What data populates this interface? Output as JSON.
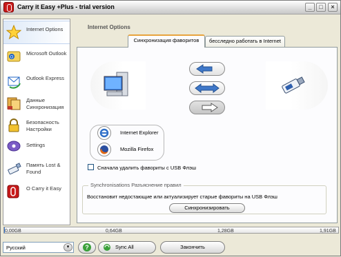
{
  "window": {
    "title": "Carry it Easy +Plus - trial version"
  },
  "titlebar": {
    "minimize": "_",
    "maximize": "□",
    "close": "×"
  },
  "sidebar": {
    "items": [
      {
        "label": "Internet Options",
        "icon": "star-icon"
      },
      {
        "label": "Microsoft Outlook",
        "icon": "outlook-icon"
      },
      {
        "label": "Outlook Express",
        "icon": "outlook-express-icon"
      },
      {
        "label": "Данные Синхронизация",
        "icon": "data-sync-icon"
      },
      {
        "label": "Безопасность Настройки",
        "icon": "lock-icon"
      },
      {
        "label": "Settings",
        "icon": "settings-icon"
      },
      {
        "label": "Память Lost & Found",
        "icon": "usb-drive-icon"
      },
      {
        "label": "О Carry it Easy",
        "icon": "about-icon"
      }
    ]
  },
  "main": {
    "title": "Internet Options",
    "tabs": [
      {
        "label": "Синхронизация фаворитов"
      },
      {
        "label": "бесследно работать в Internet"
      }
    ],
    "browsers": [
      {
        "label": "Internet Explorer",
        "icon": "internet-explorer-icon"
      },
      {
        "label": "Mozilla Firefox",
        "icon": "firefox-icon"
      }
    ],
    "delete_first_label": "Сначала удалить фавориты с USB Флэш",
    "delete_first_checked": false,
    "group_title": "Synchronisations Разъяснение правил",
    "group_text": "Восстановит недостающие или актуализирует старые фавориты на USB Флэш",
    "sync_button": "Синхронизировать"
  },
  "capacity": {
    "ticks": [
      "0,00GB",
      "0,64GB",
      "1,28GB",
      "1,91GB"
    ],
    "used_fraction": 0.003
  },
  "bottom": {
    "language": "Русский",
    "help_icon": "question-icon",
    "sync_all": "Sync All",
    "finish": "Закончить"
  },
  "colors": {
    "accent": "#e8a33c",
    "capacity_fill": "#3a7bd5"
  }
}
